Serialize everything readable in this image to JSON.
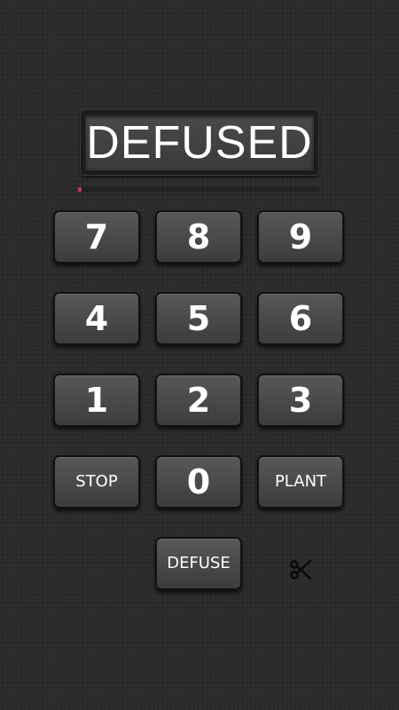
{
  "display": {
    "text": "DEFUSED"
  },
  "defuse_progress": {
    "fraction": 0.015,
    "color": "#c0395a"
  },
  "keypad": {
    "k7": "7",
    "k8": "8",
    "k9": "9",
    "k4": "4",
    "k5": "5",
    "k6": "6",
    "k1": "1",
    "k2": "2",
    "k3": "3",
    "k0": "0",
    "stop": "STOP",
    "plant": "PLANT",
    "defuse": "DEFUSE"
  },
  "tool_icon": "scissors-icon"
}
